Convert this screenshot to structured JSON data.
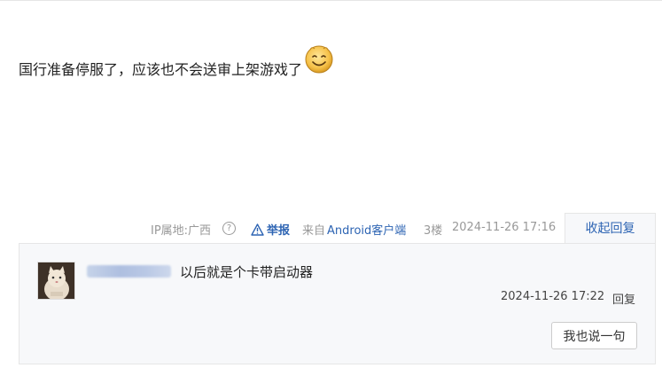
{
  "post": {
    "text": "国行准备停服了，应该也不会送审上架游戏了",
    "emoji": "smiley-face"
  },
  "meta": {
    "ip_location": "IP属地:广西",
    "report_label": "举报",
    "from_prefix": "来自",
    "client": "Android客户端",
    "floor": "3楼",
    "time": "2024-11-26 17:16",
    "collapse_label": "收起回复"
  },
  "reply": {
    "text": "以后就是个卡带启动器",
    "time": "2024-11-26 17:22",
    "reply_label": "回复",
    "button_label": "我也说一句"
  },
  "colors": {
    "link": "#2d64b3",
    "meta_gray": "#999999",
    "panel_bg": "#f7f8fa"
  }
}
